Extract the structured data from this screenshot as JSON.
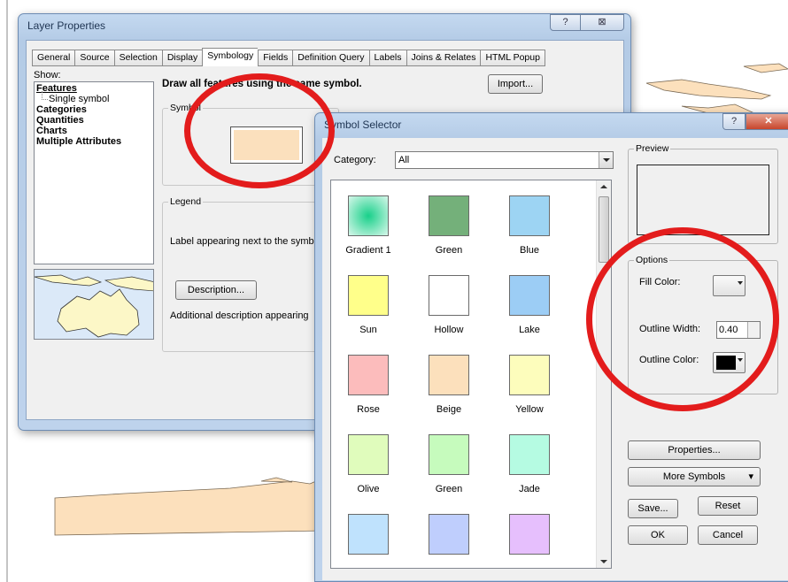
{
  "layer_properties": {
    "title": "Layer Properties",
    "help_button": "?",
    "close_button": "⊠",
    "tabs": [
      "General",
      "Source",
      "Selection",
      "Display",
      "Symbology",
      "Fields",
      "Definition Query",
      "Labels",
      "Joins & Relates",
      "HTML Popup"
    ],
    "active_tab": "Symbology",
    "show_label": "Show:",
    "show_items": {
      "features": "Features",
      "single_symbol": "Single symbol",
      "categories": "Categories",
      "quantities": "Quantities",
      "charts": "Charts",
      "multiple_attributes": "Multiple Attributes"
    },
    "draw_title": "Draw all features using the same symbol.",
    "import_button": "Import...",
    "symbol_group": "Symbol",
    "legend_group": "Legend",
    "legend_label": "Label appearing next to the symbol",
    "description_button": "Description...",
    "description_text": "Additional description appearing"
  },
  "symbol_selector": {
    "title": "Symbol Selector",
    "category_label": "Category:",
    "category_value": "All",
    "symbols": [
      {
        "name": "Gradient 1",
        "color": "#2ecc8a",
        "style": "gradient"
      },
      {
        "name": "Green",
        "color": "#74b07a"
      },
      {
        "name": "Blue",
        "color": "#9dd4f3"
      },
      {
        "name": "Sun",
        "color": "#ffff8a"
      },
      {
        "name": "Hollow",
        "color": "#ffffff"
      },
      {
        "name": "Lake",
        "color": "#9ccdf5"
      },
      {
        "name": "Rose",
        "color": "#fcbcbc"
      },
      {
        "name": "Beige",
        "color": "#fce0bc"
      },
      {
        "name": "Yellow",
        "color": "#fdfdbc"
      },
      {
        "name": "Olive",
        "color": "#e0fcbc"
      },
      {
        "name": "Green",
        "color": "#c6fbbd"
      },
      {
        "name": "Jade",
        "color": "#b5fbe2"
      },
      {
        "name": "",
        "color": "#bfe2fd"
      },
      {
        "name": "",
        "color": "#bfcefd"
      },
      {
        "name": "",
        "color": "#e6bffd"
      }
    ],
    "preview_label": "Preview",
    "options_label": "Options",
    "fill_color_label": "Fill Color:",
    "outline_width_label": "Outline Width:",
    "outline_width_value": "0.40",
    "outline_color_label": "Outline Color:",
    "outline_color": "#000000",
    "properties_button": "Properties...",
    "more_symbols_button": "More Symbols",
    "save_button": "Save...",
    "reset_button": "Reset",
    "ok_button": "OK",
    "cancel_button": "Cancel"
  },
  "highlight_color": "#e31c1c"
}
